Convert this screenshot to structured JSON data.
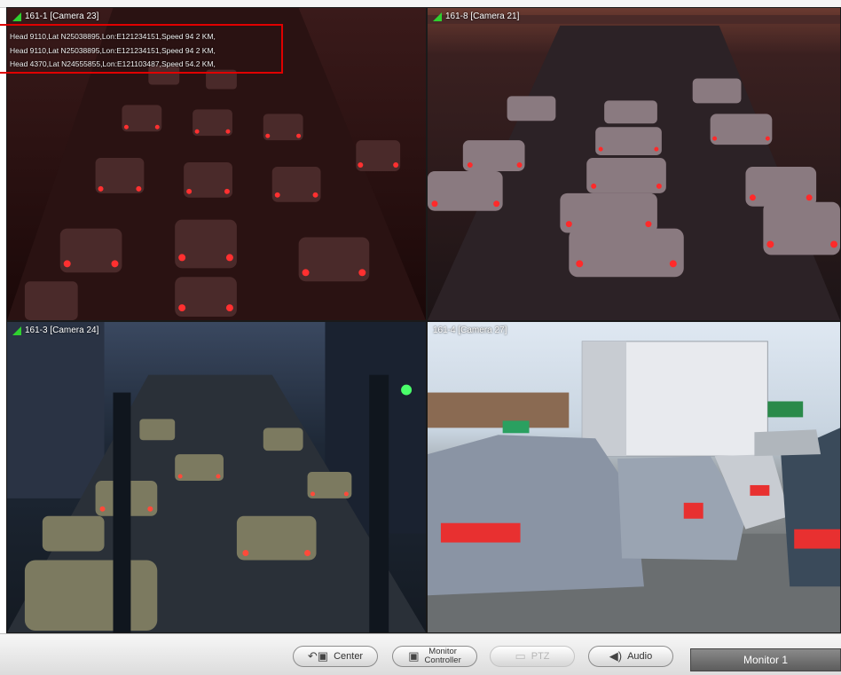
{
  "cameras": [
    {
      "label": "161-1 [Camera 23]",
      "theme": "night-red"
    },
    {
      "label": "161-8 [Camera 21]",
      "theme": "dusk-highway"
    },
    {
      "label": "161-3 [Camera 24]",
      "theme": "city-blue"
    },
    {
      "label": "161-4 [Camera 27]",
      "theme": "day-street"
    }
  ],
  "overlay": {
    "lines": [
      "Head 9110,Lat N25038895,Lon:E121234151,Speed 94 2 KM,",
      "Head 9110,Lat N25038895,Lon:E121234151,Speed 94 2 KM,",
      "Head 4370,Lat N24555855,Lon:E121103487,Speed 54.2 KM,"
    ],
    "border_color": "#e00000"
  },
  "toolbar": {
    "center_label": "Center",
    "monitor_controller_line1": "Monitor",
    "monitor_controller_line2": "Controller",
    "ptz_label": "PTZ",
    "audio_label": "Audio",
    "monitor_label": "Monitor 1"
  },
  "icons": {
    "center": "center-icon",
    "monitor_controller": "monitor-controller-icon",
    "ptz": "ptz-icon",
    "audio": "speaker-icon",
    "signal": "signal-icon"
  },
  "colors": {
    "signal": "#2fd12f",
    "overlay_border": "#e00000",
    "monitor_bg": "#6e6e6e"
  }
}
